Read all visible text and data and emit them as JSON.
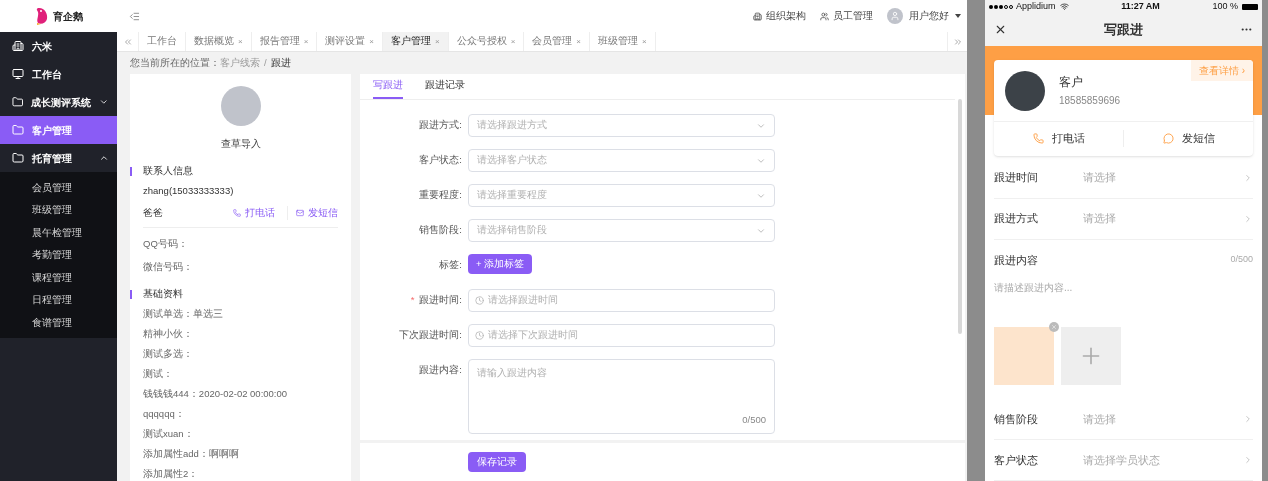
{
  "brand": "育企鹅",
  "topbar": {
    "links": [
      {
        "label": "组织架构"
      },
      {
        "label": "员工管理"
      }
    ],
    "user": "用户您好"
  },
  "sidebar": {
    "items": [
      {
        "label": "六米",
        "kind": "building",
        "selected": false
      },
      {
        "label": "工作台",
        "kind": "monitor",
        "selected": false
      },
      {
        "label": "成长测评系统",
        "kind": "folder",
        "selected": false,
        "expanded": false
      },
      {
        "label": "客户管理",
        "kind": "folder",
        "selected": true
      },
      {
        "label": "托育管理",
        "kind": "folder",
        "selected": false,
        "expanded": true,
        "children": [
          {
            "label": "会员管理"
          },
          {
            "label": "班级管理"
          },
          {
            "label": "晨午检管理"
          },
          {
            "label": "考勤管理"
          },
          {
            "label": "课程管理"
          },
          {
            "label": "日程管理"
          },
          {
            "label": "食谱管理"
          }
        ]
      }
    ]
  },
  "tabs": [
    {
      "label": "工作台",
      "closable": false,
      "selected": false
    },
    {
      "label": "数据概览",
      "closable": true,
      "selected": false
    },
    {
      "label": "报告管理",
      "closable": true,
      "selected": false
    },
    {
      "label": "测评设置",
      "closable": true,
      "selected": false
    },
    {
      "label": "客户管理",
      "closable": true,
      "selected": true
    },
    {
      "label": "公众号授权",
      "closable": true,
      "selected": false
    },
    {
      "label": "会员管理",
      "closable": true,
      "selected": false
    },
    {
      "label": "班级管理",
      "closable": true,
      "selected": false
    }
  ],
  "tab_close": "×",
  "breadcrumb": {
    "label": "您当前所在的位置：",
    "path": [
      "客户线索",
      "跟进"
    ],
    "separator": "/"
  },
  "profile": {
    "name": "查草导入",
    "contact": {
      "title": "联系人信息",
      "name": "zhang(15033333333)",
      "relation": "爸爸",
      "call": "打电话",
      "sms": "发短信",
      "fields": [
        "QQ号码：",
        "微信号码："
      ]
    },
    "basic": {
      "title": "基础资料",
      "fields": [
        "测试单选：单选三",
        "精神小伙：",
        "测试多选：",
        "测试：",
        "钱钱钱444：2020-02-02 00:00:00",
        "qqqqqq：",
        "测试xuan：",
        "添加属性add：啊啊啊",
        "添加属性2："
      ]
    }
  },
  "form": {
    "tabs": [
      {
        "label": "写跟进",
        "selected": true
      },
      {
        "label": "跟进记录",
        "selected": false
      }
    ],
    "fields": [
      {
        "kind": "select",
        "label": "跟进方式:",
        "placeholder": "请选择跟进方式",
        "required": false
      },
      {
        "kind": "select",
        "label": "客户状态:",
        "placeholder": "请选择客户状态",
        "required": false
      },
      {
        "kind": "select",
        "label": "重要程度:",
        "placeholder": "请选择重要程度",
        "required": false
      },
      {
        "kind": "select",
        "label": "销售阶段:",
        "placeholder": "请选择销售阶段",
        "required": false
      },
      {
        "kind": "tag",
        "label": "标签:",
        "button": "+ 添加标签",
        "required": false
      },
      {
        "kind": "date",
        "label": "跟进时间:",
        "placeholder": "请选择跟进时间",
        "required": true
      },
      {
        "kind": "date",
        "label": "下次跟进时间:",
        "placeholder": "请选择下次跟进时间",
        "required": false
      },
      {
        "kind": "textarea",
        "label": "跟进内容:",
        "placeholder": "请输入跟进内容",
        "counter": "0/500",
        "required": false
      }
    ],
    "required_mark": "*",
    "save": "保存记录"
  },
  "phone": {
    "status": {
      "carrier": "Applidium",
      "time": "11:27 AM",
      "battery": "100 %"
    },
    "title": "写跟进",
    "customer": {
      "name": "客户",
      "phone": "18585859696",
      "details": "查看详情 ›",
      "call": "打电话",
      "sms": "发短信"
    },
    "rows": [
      {
        "kind": "picker",
        "label": "跟进时间",
        "value": "请选择"
      },
      {
        "kind": "picker",
        "label": "跟进方式",
        "value": "请选择"
      },
      {
        "kind": "text",
        "label": "跟进内容",
        "counter": "0/500",
        "placeholder": "请描述跟进内容..."
      },
      {
        "kind": "picker",
        "label": "销售阶段",
        "value": "请选择"
      },
      {
        "kind": "picker",
        "label": "客户状态",
        "value": "请选择学员状态"
      }
    ]
  }
}
